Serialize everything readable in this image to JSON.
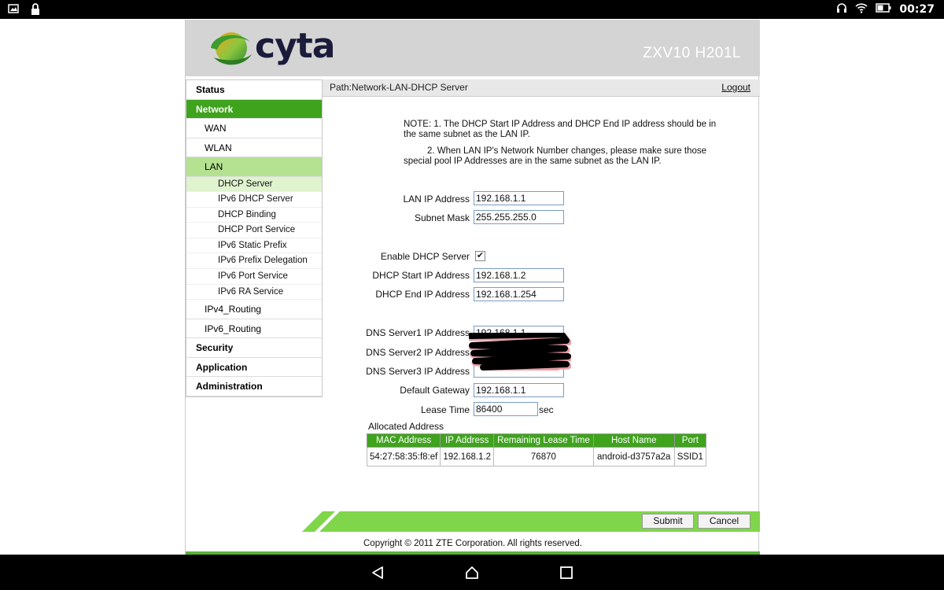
{
  "statusbar": {
    "time": "00:27",
    "left_icons": [
      "image-icon",
      "lock-icon"
    ],
    "right_icons": [
      "headset-icon",
      "wifi-icon",
      "battery-icon"
    ]
  },
  "header": {
    "logo_text": "cyta",
    "model": "ZXV10 H201L"
  },
  "sidebar": {
    "items": [
      {
        "label": "Status",
        "level": "top",
        "active": false
      },
      {
        "label": "Network",
        "level": "top",
        "active": true
      },
      {
        "label": "WAN",
        "level": "sub",
        "active": false
      },
      {
        "label": "WLAN",
        "level": "sub",
        "active": false
      },
      {
        "label": "LAN",
        "level": "sub",
        "active": true
      },
      {
        "label": "DHCP Server",
        "level": "leaf",
        "active": true
      },
      {
        "label": "IPv6 DHCP Server",
        "level": "leaf",
        "active": false
      },
      {
        "label": "DHCP Binding",
        "level": "leaf",
        "active": false
      },
      {
        "label": "DHCP Port Service",
        "level": "leaf",
        "active": false
      },
      {
        "label": "IPv6 Static Prefix",
        "level": "leaf",
        "active": false
      },
      {
        "label": "IPv6 Prefix Delegation",
        "level": "leaf",
        "active": false
      },
      {
        "label": "IPv6 Port Service",
        "level": "leaf",
        "active": false
      },
      {
        "label": "IPv6 RA Service",
        "level": "leaf",
        "active": false
      },
      {
        "label": "IPv4_Routing",
        "level": "sub",
        "active": false
      },
      {
        "label": "IPv6_Routing",
        "level": "sub",
        "active": false
      },
      {
        "label": "Security",
        "level": "top",
        "active": false
      },
      {
        "label": "Application",
        "level": "top",
        "active": false
      },
      {
        "label": "Administration",
        "level": "top",
        "active": false
      }
    ]
  },
  "pathbar": {
    "path": "Path:Network-LAN-DHCP Server",
    "logout": "Logout"
  },
  "note": {
    "line1": "NOTE:  1. The DHCP Start IP Address and DHCP End IP address should be in the same subnet as the LAN IP.",
    "line2": "2. When LAN IP's Network Number changes, please make sure those special pool IP Addresses are in the same subnet as the LAN IP."
  },
  "form": {
    "lan_ip": {
      "label": "LAN IP Address",
      "value": "192.168.1.1"
    },
    "subnet": {
      "label": "Subnet Mask",
      "value": "255.255.255.0"
    },
    "enable_dhcp": {
      "label": "Enable DHCP Server",
      "checked": true,
      "mark": "✔"
    },
    "start_ip": {
      "label": "DHCP Start IP Address",
      "value": "192.168.1.2"
    },
    "end_ip": {
      "label": "DHCP End IP Address",
      "value": "192.168.1.254"
    },
    "dns1": {
      "label": "DNS Server1 IP Address",
      "value": "192.168.1.1"
    },
    "dns2": {
      "label": "DNS Server2 IP Address",
      "value": ""
    },
    "dns3": {
      "label": "DNS Server3 IP Address",
      "value": ""
    },
    "gateway": {
      "label": "Default Gateway",
      "value": "192.168.1.1"
    },
    "lease": {
      "label": "Lease Time",
      "value": "86400",
      "unit": "sec"
    }
  },
  "allocated": {
    "title": "Allocated Address",
    "columns": [
      "MAC Address",
      "IP Address",
      "Remaining Lease Time",
      "Host Name",
      "Port"
    ],
    "rows": [
      [
        "54:27:58:35:f8:ef",
        "192.168.1.2",
        "76870",
        "android-d3757a2a",
        "SSID1"
      ]
    ]
  },
  "buttons": {
    "submit": "Submit",
    "cancel": "Cancel"
  },
  "footer": {
    "copyright": "Copyright © 2011 ZTE Corporation. All rights reserved."
  },
  "colors": {
    "brand_green": "#3fa31d",
    "light_green": "#b4e291",
    "bar_green": "#7fd64a",
    "header_gray": "#d4d4d4"
  }
}
